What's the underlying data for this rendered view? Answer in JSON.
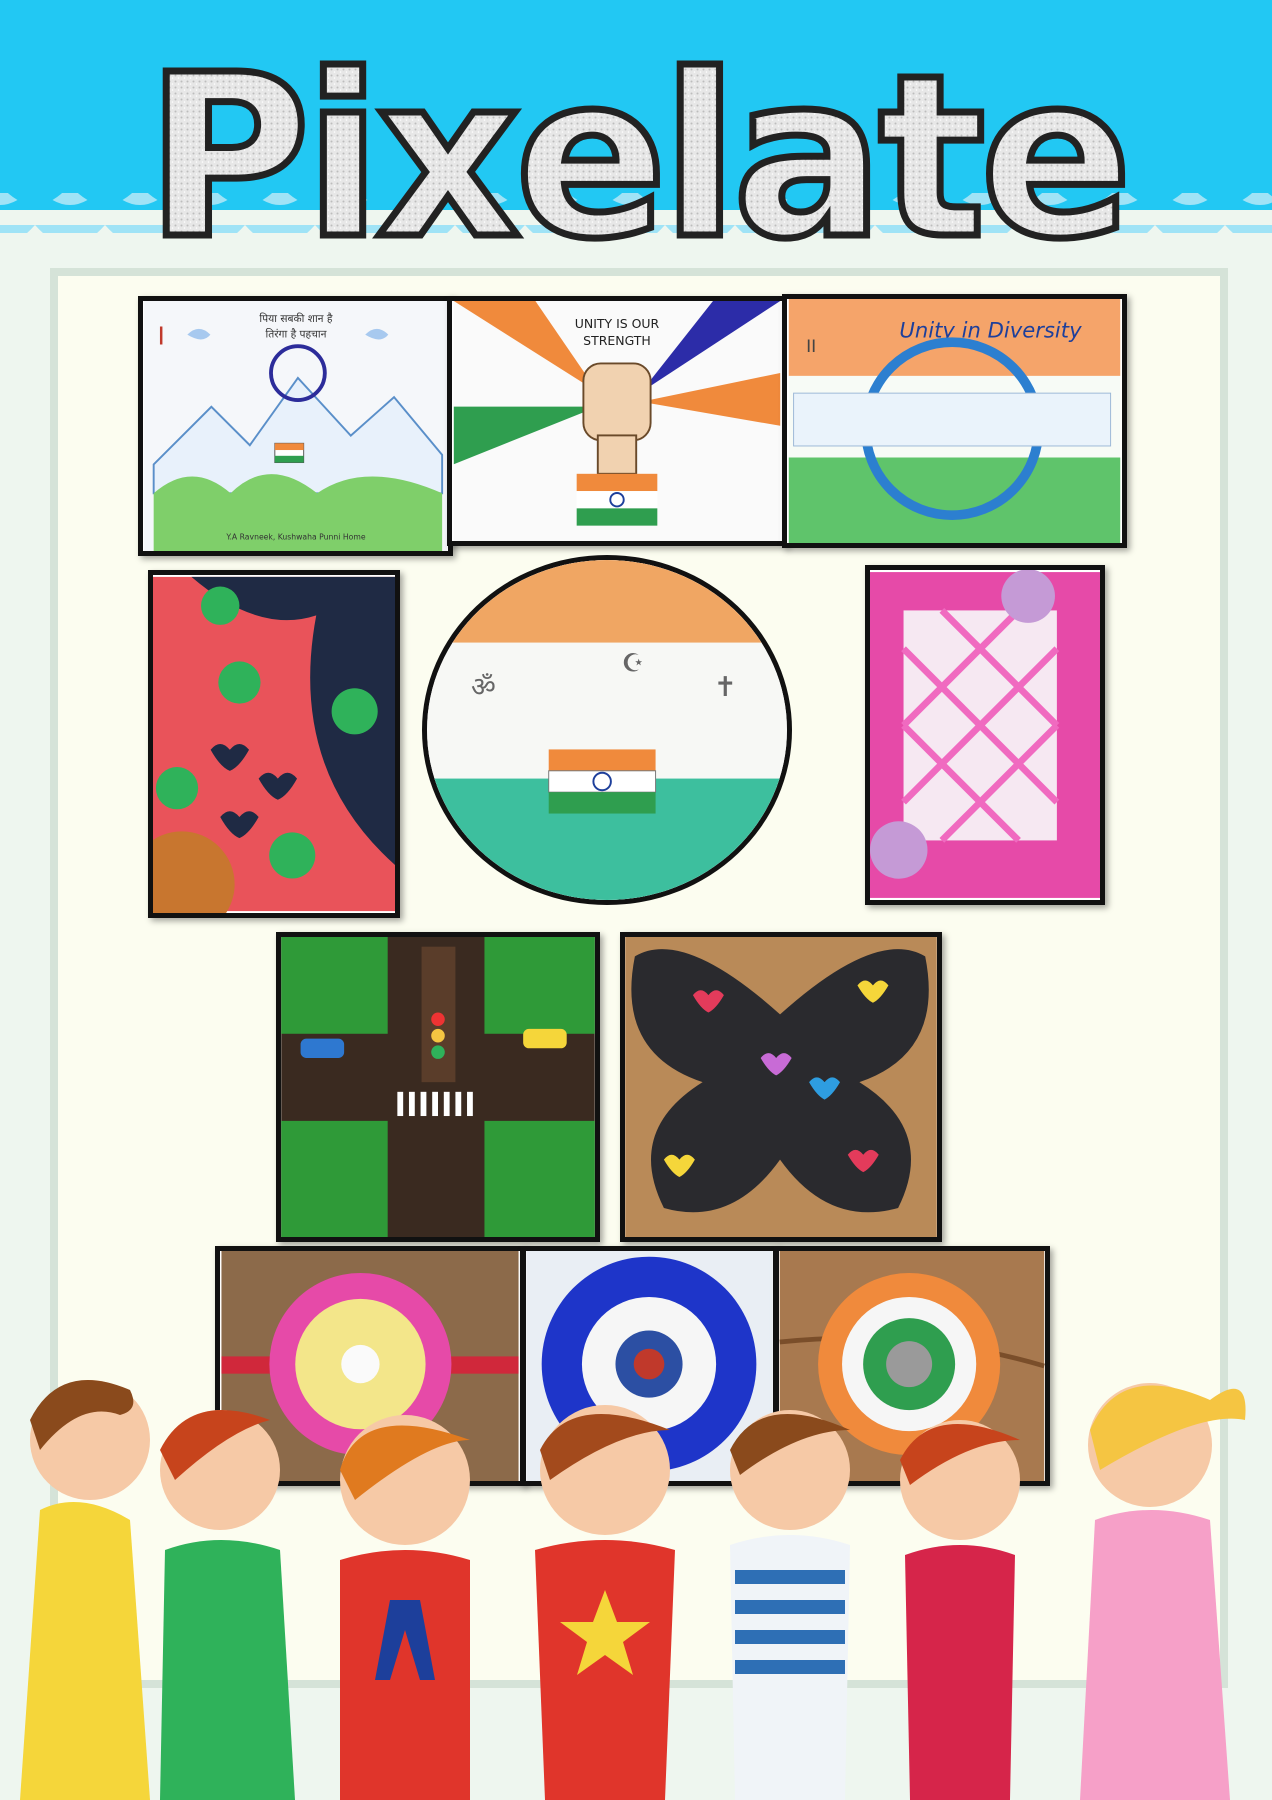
{
  "title": "Pixelate",
  "artworks": {
    "drawing_1": {
      "numeral": "I",
      "caption_line1": "पिया सबकी शान है",
      "caption_line2": "तिरंगा है पहचान",
      "signature": "Y.A Ravneek, Kushwaha  Punni Home"
    },
    "drawing_2": {
      "caption_line1": "UNITY IS OUR",
      "caption_line2": "STRENGTH"
    },
    "drawing_3": {
      "numeral": "II",
      "caption": "Unity in Diversity"
    },
    "drawing_5": {
      "symbols": [
        "ॐ",
        "☪",
        "✝"
      ]
    }
  },
  "colors": {
    "header": "#22c8f3",
    "board": "#fcfdf0",
    "saffron": "#f08a3c",
    "green": "#2f9e4f",
    "navy": "#1d3f9b",
    "pink": "#e64aa8"
  }
}
